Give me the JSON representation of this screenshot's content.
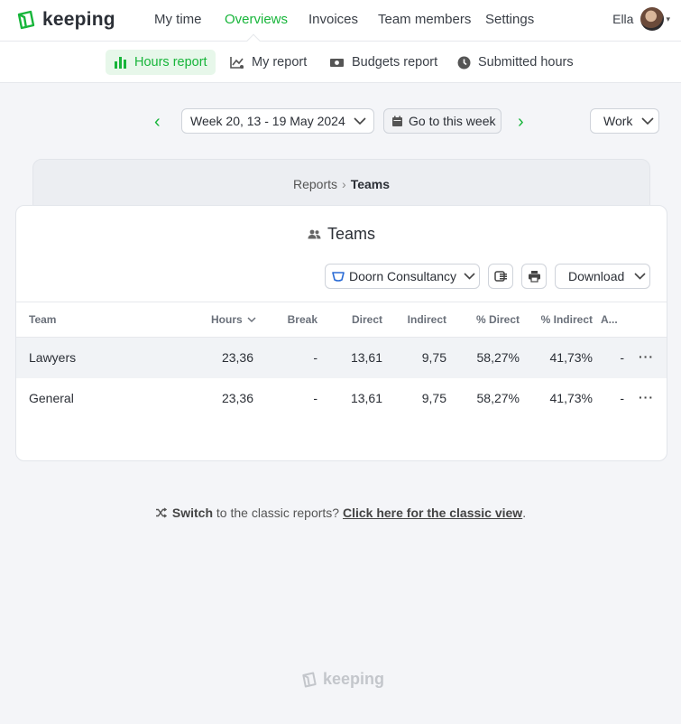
{
  "brand": {
    "name": "keeping",
    "color": "#17b53a"
  },
  "topnav": {
    "items": [
      "My time",
      "Overviews",
      "Invoices",
      "Team members",
      "Settings"
    ],
    "active": "Overviews",
    "user": {
      "name": "Ella"
    }
  },
  "subnav": {
    "items": [
      {
        "label": "Hours report",
        "icon": "bar-chart-icon"
      },
      {
        "label": "My report",
        "icon": "line-chart-icon"
      },
      {
        "label": "Budgets report",
        "icon": "money-icon"
      },
      {
        "label": "Submitted hours",
        "icon": "clock-icon"
      }
    ],
    "active": "Hours report"
  },
  "weekbar": {
    "week_label": "Week 20, 13 - 19 May 2024",
    "goto_label": "Go to this week",
    "filter_label": "Work"
  },
  "breadcrumb": {
    "parent": "Reports",
    "current": "Teams"
  },
  "report": {
    "title": "Teams",
    "client_select": "Doorn Consultancy",
    "download_label": "Download",
    "columns": [
      "Team",
      "Hours",
      "Break",
      "Direct",
      "Indirect",
      "% Direct",
      "% Indirect",
      "A..."
    ],
    "rows": [
      {
        "team": "Lawyers",
        "hours": "23,36",
        "break": "-",
        "direct": "13,61",
        "indirect": "9,75",
        "pct_direct": "58,27%",
        "pct_indirect": "41,73%",
        "a": "-"
      },
      {
        "team": "General",
        "hours": "23,36",
        "break": "-",
        "direct": "13,61",
        "indirect": "9,75",
        "pct_direct": "58,27%",
        "pct_indirect": "41,73%",
        "a": "-"
      }
    ]
  },
  "classic": {
    "switch_word": "Switch",
    "middle_text": " to the classic reports? ",
    "link_text": "Click here for the classic view",
    "end": "."
  }
}
